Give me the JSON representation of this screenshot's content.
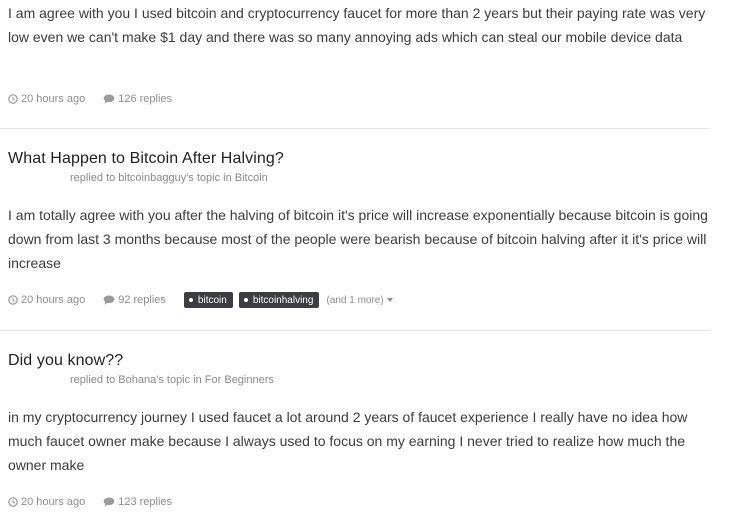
{
  "posts": [
    {
      "body": "I am agree with you I used bitcoin and cryptocurrency faucet for more than 2 years but their paying rate was very low even we can't make $1 day and there was so many annoying ads which can steal our mobile device data",
      "time": "20 hours ago",
      "replies": "126 replies"
    },
    {
      "title": "What Happen to Bitcoin After Halving?",
      "subtitle": "replied to bitcoinbagguy's topic in Bitcoin",
      "body": "I am totally agree with you after the halving of bitcoin it's price will increase exponentially because bitcoin is going down from last 3 months because most of the people were bearish because of bitcoin halving after it it's price will increase",
      "time": "20 hours ago",
      "replies": "92 replies",
      "tags": [
        "bitcoin",
        "bitcoinhalving"
      ],
      "more_tags": "(and 1 more)"
    },
    {
      "title": "Did you know??",
      "subtitle": "replied to Bohana's topic in For Beginners",
      "body": "in my cryptocurrency journey I used faucet a lot around 2 years of faucet experience I really have no idea how much faucet owner make because I always used to focus on my earning I never tried to realize how much the owner make",
      "time": "20 hours ago",
      "replies": "123 replies"
    }
  ],
  "icons": {
    "time": "clock-icon",
    "replies": "comment-icon",
    "more": "caret-down-icon"
  },
  "colors": {
    "tag_background": "#3a3d42",
    "meta_text": "#8e8e8e"
  }
}
